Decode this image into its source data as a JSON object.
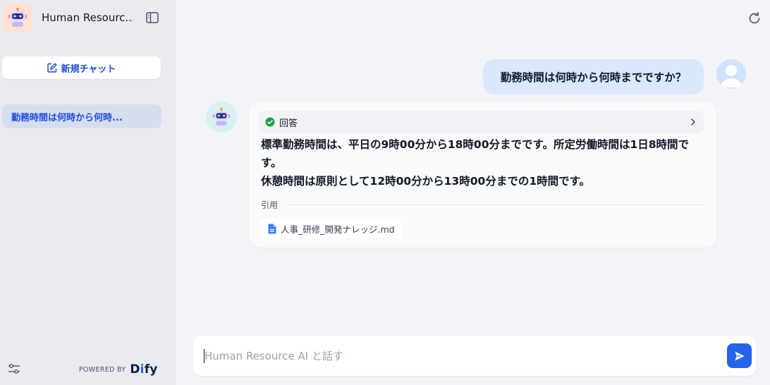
{
  "app": {
    "title": "Human Resource AI",
    "title_display": "Human Resourc...",
    "avatar_icon": "robot-icon"
  },
  "sidebar": {
    "new_chat_label": "新規チャット",
    "conversations": [
      {
        "label": "勤務時間は何時から何時..."
      }
    ],
    "powered_by_label": "POWERED BY",
    "brand": {
      "pre": "D",
      "dot": "i",
      "post": "fy"
    }
  },
  "chat": {
    "user_message": "勤務時間は何時から何時までですか？",
    "workflow_label": "回答",
    "answer_line1": "標準勤務時間は、平日の9時00分から18時00分までです。所定労働時間は1日8時間です。",
    "answer_line2": "休憩時間は原則として12時00分から13時00分までの1時間です。",
    "citation_label": "引用",
    "citations": [
      {
        "name": "人事_研修_開発ナレッジ.md"
      }
    ]
  },
  "input": {
    "placeholder": "Human Resource AI と話す",
    "value": ""
  },
  "colors": {
    "accent": "#2563eb",
    "link": "#1d4ed8",
    "user_bubble": "#d9e8fc",
    "sidebar_bg": "#e9ebf0",
    "main_bg": "#f2f4f7",
    "success": "#16a34a"
  }
}
